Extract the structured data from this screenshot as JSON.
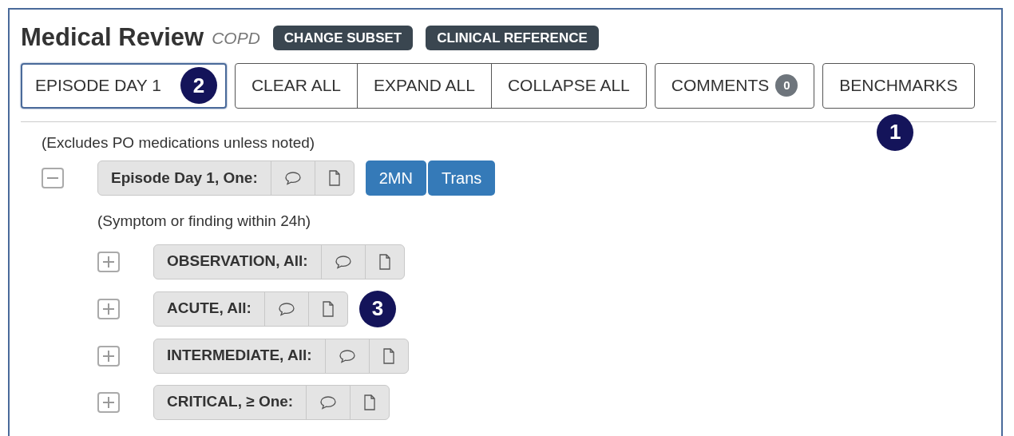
{
  "header": {
    "title": "Medical Review",
    "subset": "COPD",
    "buttons": [
      "CHANGE SUBSET",
      "CLINICAL REFERENCE"
    ]
  },
  "toolbar": {
    "episode": {
      "label": "EPISODE DAY 1",
      "selected": true,
      "callout": "2"
    },
    "group": [
      "CLEAR ALL",
      "EXPAND ALL",
      "COLLAPSE ALL"
    ],
    "comments": {
      "label": "COMMENTS",
      "count": "0"
    },
    "benchmarks": {
      "label": "BENCHMARKS",
      "callout": "1"
    }
  },
  "note": "(Excludes PO medications unless noted)",
  "tree": [
    {
      "label": "Episode Day 1, One:",
      "expanded": true,
      "tags": [
        "2MN",
        "Trans"
      ],
      "note": "(Symptom or finding within 24h)",
      "children": [
        {
          "label": "OBSERVATION, All:",
          "expanded": false
        },
        {
          "label": "ACUTE, All:",
          "expanded": false,
          "callout": "3"
        },
        {
          "label": "INTERMEDIATE, All:",
          "expanded": false
        },
        {
          "label": "CRITICAL, ≥ One:",
          "expanded": false
        }
      ]
    }
  ]
}
